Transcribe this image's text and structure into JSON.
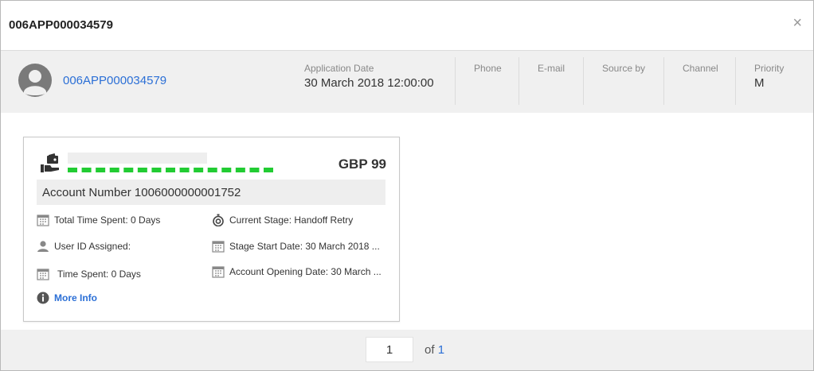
{
  "dialog": {
    "title": "006APP000034579",
    "close_glyph": "×"
  },
  "info": {
    "app_id": "006APP000034579",
    "fields": [
      {
        "label": "Application Date",
        "value": "30 March 2018 12:00:00"
      },
      {
        "label": "Phone",
        "value": ""
      },
      {
        "label": "E-mail",
        "value": ""
      },
      {
        "label": "Source by",
        "value": ""
      },
      {
        "label": "Channel",
        "value": ""
      },
      {
        "label": "Priority",
        "value": "M"
      }
    ]
  },
  "card": {
    "amount": "GBP 99",
    "account_number": "Account Number 1006000000001752",
    "left_items": [
      {
        "icon": "calendar-icon",
        "text": "Total Time Spent: 0 Days"
      },
      {
        "icon": "user-icon",
        "text": "User ID Assigned:"
      },
      {
        "icon": "calendar-icon",
        "text": "Time Spent: 0 Days"
      }
    ],
    "right_items": [
      {
        "icon": "stopwatch-icon",
        "text": "Current Stage: Handoff Retry"
      },
      {
        "icon": "calendar-icon",
        "text": "Stage Start Date: 30 March 2018 ..."
      },
      {
        "icon": "calendar-icon",
        "text": "Account Opening Date: 30 March ..."
      }
    ],
    "more_info": "More Info"
  },
  "pagination": {
    "current": "1",
    "of_label": "of",
    "total": "1"
  },
  "colors": {
    "link": "#2b6fd6",
    "redaction": "#22cc33",
    "band": "#f0f0f0"
  }
}
